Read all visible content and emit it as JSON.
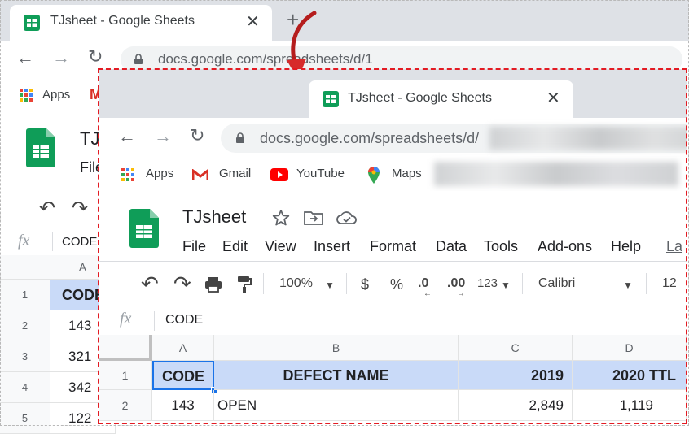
{
  "colors": {
    "frame": "#e31b23",
    "sheets_green": "#0f9d58",
    "header_fill": "#c9daf8",
    "tab_strip": "#dee1e6"
  },
  "background_window": {
    "tab_title": "TJsheet - Google Sheets",
    "url": "docs.google.com/spreadsheets/d/1",
    "bookmark_apps": "Apps",
    "doc_title_partial": "TJs",
    "menu_partial": "File",
    "formula_icon": "fx",
    "formula_value": "CODE",
    "column_a": "A",
    "rows": [
      {
        "num": "1",
        "value": "CODE"
      },
      {
        "num": "2",
        "value": "143"
      },
      {
        "num": "3",
        "value": "321"
      },
      {
        "num": "4",
        "value": "342"
      },
      {
        "num": "5",
        "value": "122"
      }
    ]
  },
  "front_window": {
    "tab_title": "TJsheet - Google Sheets",
    "url": "docs.google.com/spreadsheets/d/",
    "bookmarks": [
      {
        "label": "Apps",
        "icon": "apps-grid-icon"
      },
      {
        "label": "Gmail",
        "icon": "gmail-icon"
      },
      {
        "label": "YouTube",
        "icon": "youtube-icon"
      },
      {
        "label": "Maps",
        "icon": "maps-icon"
      }
    ],
    "doc_title": "TJsheet",
    "menu": [
      "File",
      "Edit",
      "View",
      "Insert",
      "Format",
      "Data",
      "Tools",
      "Add-ons",
      "Help",
      "La"
    ],
    "toolbar": {
      "zoom": "100%",
      "currency": "$",
      "percent": "%",
      "dec_decrease": ".0",
      "dec_increase": ".00",
      "number_format": "123",
      "font": "Calibri",
      "font_size": "12"
    },
    "formula_icon": "fx",
    "formula_value": "CODE",
    "columns": [
      "A",
      "B",
      "C",
      "D"
    ],
    "rows": [
      {
        "num": "1",
        "cells": [
          "CODE",
          "DEFECT NAME",
          "2019",
          "2020 TTL"
        ]
      },
      {
        "num": "2",
        "cells": [
          "143",
          "OPEN",
          "2,849",
          "1,119"
        ]
      }
    ]
  }
}
